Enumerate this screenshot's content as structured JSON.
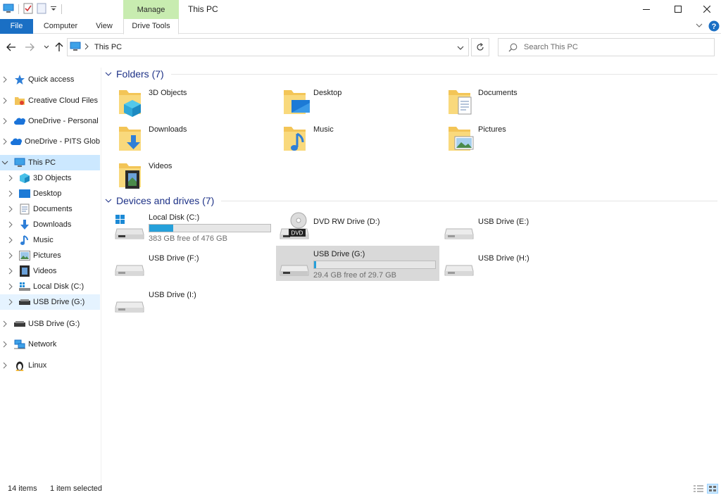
{
  "window": {
    "title": "This PC",
    "manage_label": "Manage",
    "colors": {
      "accent": "#1a6fc4",
      "manage_bg": "#c8ecb0",
      "selection": "#cce8ff",
      "progress": "#26a0da"
    }
  },
  "ribbon": {
    "tabs": [
      {
        "label": "File"
      },
      {
        "label": "Computer"
      },
      {
        "label": "View"
      },
      {
        "label": "Drive Tools"
      }
    ]
  },
  "address": {
    "path": "This PC"
  },
  "search": {
    "placeholder": "Search This PC"
  },
  "sidebar": {
    "items": [
      {
        "label": "Quick access",
        "icon": "star-icon"
      },
      {
        "label": "Creative Cloud Files",
        "icon": "cloud-folder-icon"
      },
      {
        "label": "OneDrive - Personal",
        "icon": "onedrive-icon"
      },
      {
        "label": "OneDrive - PITS Glob",
        "icon": "onedrive-icon"
      },
      {
        "label": "This PC",
        "icon": "computer-icon"
      },
      {
        "label": "3D Objects",
        "icon": "cube-icon"
      },
      {
        "label": "Desktop",
        "icon": "desktop-icon"
      },
      {
        "label": "Documents",
        "icon": "document-icon"
      },
      {
        "label": "Downloads",
        "icon": "download-icon"
      },
      {
        "label": "Music",
        "icon": "music-icon"
      },
      {
        "label": "Pictures",
        "icon": "picture-icon"
      },
      {
        "label": "Videos",
        "icon": "video-icon"
      },
      {
        "label": "Local Disk (C:)",
        "icon": "windows-drive-icon"
      },
      {
        "label": "USB Drive (G:)",
        "icon": "usb-drive-icon"
      },
      {
        "label": "USB Drive (G:)",
        "icon": "usb-drive-icon"
      },
      {
        "label": "Network",
        "icon": "network-icon"
      },
      {
        "label": "Linux",
        "icon": "linux-icon"
      }
    ]
  },
  "content": {
    "folders_header": "Folders (7)",
    "folders": [
      {
        "label": "3D Objects",
        "icon": "cube-icon"
      },
      {
        "label": "Desktop",
        "icon": "desktop-icon"
      },
      {
        "label": "Documents",
        "icon": "document-icon"
      },
      {
        "label": "Downloads",
        "icon": "download-icon"
      },
      {
        "label": "Music",
        "icon": "music-icon"
      },
      {
        "label": "Pictures",
        "icon": "picture-icon"
      },
      {
        "label": "Videos",
        "icon": "video-icon"
      }
    ],
    "drives_header": "Devices and drives (7)",
    "drives": [
      {
        "label": "Local Disk (C:)",
        "free": "383 GB free of 476 GB",
        "used_fraction": 0.2,
        "icon": "windows-drive-icon"
      },
      {
        "label": "DVD RW Drive (D:)",
        "icon": "dvd-drive-icon",
        "badge": "DVD"
      },
      {
        "label": "USB Drive (E:)",
        "icon": "usb-drive-icon"
      },
      {
        "label": "USB Drive (F:)",
        "icon": "usb-drive-icon"
      },
      {
        "label": "USB Drive (G:)",
        "free": "29.4 GB free of 29.7 GB",
        "used_fraction": 0.01,
        "icon": "usb-drive-icon"
      },
      {
        "label": "USB Drive (H:)",
        "icon": "usb-drive-icon"
      },
      {
        "label": "USB Drive (I:)",
        "icon": "usb-drive-icon"
      }
    ]
  },
  "status": {
    "items": "14 items",
    "selected": "1 item selected"
  }
}
